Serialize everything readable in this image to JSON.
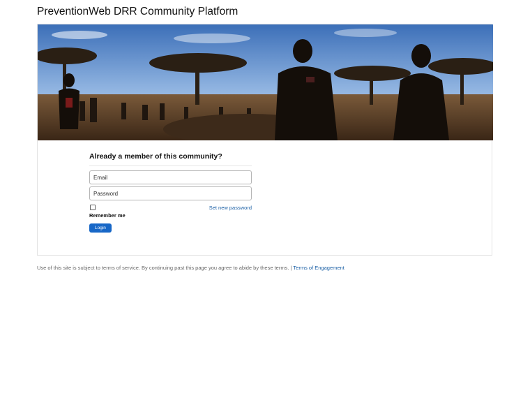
{
  "header": {
    "title": "PreventionWeb DRR Community Platform"
  },
  "login": {
    "heading": "Already a member of this community?",
    "email_placeholder": "Email",
    "password_placeholder": "Password",
    "set_password_label": "Set new password",
    "remember_label": "Remember me",
    "login_label": "Login"
  },
  "footer": {
    "notice": "Use of this site is subject to terms of service. By continuing past this page you agree to abide by these terms. |",
    "terms_link": "Terms of Engagement"
  },
  "colors": {
    "link": "#1a5fa5",
    "button": "#1767c7"
  }
}
